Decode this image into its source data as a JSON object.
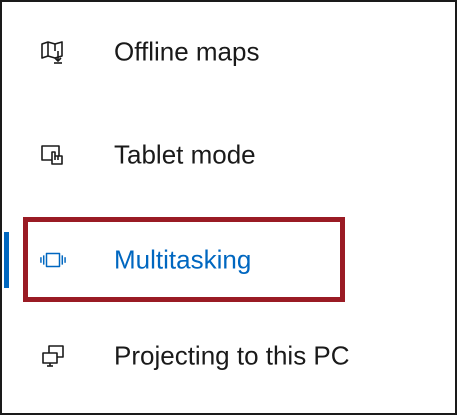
{
  "nav": {
    "items": [
      {
        "label": "Offline maps",
        "icon": "map-icon",
        "selected": false
      },
      {
        "label": "Tablet mode",
        "icon": "tablet-mode-icon",
        "selected": false
      },
      {
        "label": "Multitasking",
        "icon": "multitasking-icon",
        "selected": true
      },
      {
        "label": "Projecting to this PC",
        "icon": "projecting-icon",
        "selected": false
      }
    ]
  },
  "colors": {
    "accent": "#0067c0",
    "highlight_border": "#9a1b24",
    "text": "#1a1a1a",
    "background": "#ffffff"
  }
}
